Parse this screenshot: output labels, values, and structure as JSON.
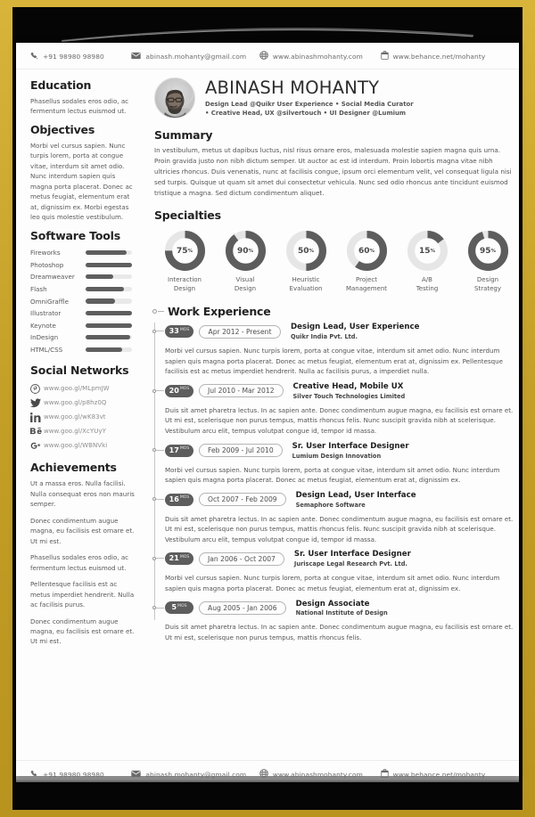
{
  "contact": {
    "phone": "+91 98980 98980",
    "email": "abinash.mohanty@gmail.com",
    "website": "www.abinashmohanty.com",
    "behance": "www.behance.net/mohanty"
  },
  "profile": {
    "name": "ABINASH MOHANTY",
    "subtitle_line1": "Design Lead @Quikr User Experience • Social Media Curator",
    "subtitle_line2": "• Creative Head, UX @silvertouch • UI Designer @Lumium"
  },
  "education": {
    "heading": "Education",
    "text": "Phasellus sodales eros odio, ac fermentum lectus euismod ut."
  },
  "objectives": {
    "heading": "Objectives",
    "text": "Morbi vel cursus sapien. Nunc turpis lorem, porta at congue vitae, interdum sit amet odio. Nunc interdum sapien quis magna porta placerat. Donec ac metus feugiat, elementum erat at, dignissim ex. Morbi egestas leo quis molestie vestibulum."
  },
  "software_tools": {
    "heading": "Software Tools",
    "items": [
      {
        "name": "Fireworks",
        "level": 88
      },
      {
        "name": "Photoshop",
        "level": 100
      },
      {
        "name": "Dreamweaver",
        "level": 60
      },
      {
        "name": "Flash",
        "level": 82
      },
      {
        "name": "OmniGraffle",
        "level": 64
      },
      {
        "name": "Illustrator",
        "level": 100
      },
      {
        "name": "Keynote",
        "level": 100
      },
      {
        "name": "InDesign",
        "level": 96
      },
      {
        "name": "HTML/CSS",
        "level": 78
      }
    ]
  },
  "social_networks": {
    "heading": "Social Networks",
    "items": [
      {
        "icon": "pinterest-icon",
        "url": "www.goo.gl/MLpmJW"
      },
      {
        "icon": "twitter-icon",
        "url": "www.goo.gl/p8hz0Q"
      },
      {
        "icon": "linkedin-icon",
        "url": "www.goo.gl/wK83vt"
      },
      {
        "icon": "behance-icon",
        "url": "www.goo.gl/XcYUyY"
      },
      {
        "icon": "googleplus-icon",
        "url": "www.goo.gl/WBNVki"
      }
    ]
  },
  "achievements": {
    "heading": "Achievements",
    "paragraphs": [
      "Ut a massa eros. Nulla facilisi. Nulla consequat eros non mauris semper.",
      "Donec condimentum augue magna, eu facilisis est ornare et. Ut mi est.",
      "Phasellus sodales eros odio, ac fermentum lectus euismod ut.",
      "Pellentesque facilisis est ac metus imperdiet hendrerit. Nulla ac facilisis purus.",
      "Donec condimentum augue magna, eu facilisis est ornare et. Ut mi est."
    ]
  },
  "summary": {
    "heading": "Summary",
    "text": "In vestibulum, metus ut dapibus luctus, nisl risus ornare eros, malesuada molestie sapien magna quis urna. Proin gravida justo non nibh dictum semper. Ut auctor ac est id interdum. Proin lobortis magna vitae nibh ultricies rhoncus. Duis venenatis, nunc at facilisis congue, ipsum orci elementum velit, vel consequat ligula nisi sed turpis. Quisque ut quam sit amet dui consectetur vehicula. Nunc sed odio rhoncus ante tincidunt euismod tristique a magna. Sed dictum condimentum aliquet."
  },
  "specialties": {
    "heading": "Specialties",
    "items": [
      {
        "value": 75,
        "value_label": "75",
        "unit": "%",
        "label_line1": "Interaction",
        "label_line2": "Design"
      },
      {
        "value": 90,
        "value_label": "90",
        "unit": "%",
        "label_line1": "Visual",
        "label_line2": "Design"
      },
      {
        "value": 50,
        "value_label": "50",
        "unit": "%",
        "label_line1": "Heuristic",
        "label_line2": "Evaluation"
      },
      {
        "value": 60,
        "value_label": "60",
        "unit": "%",
        "label_line1": "Project",
        "label_line2": "Management"
      },
      {
        "value": 15,
        "value_label": "15",
        "unit": "%",
        "label_line1": "A/B",
        "label_line2": "Testing"
      },
      {
        "value": 95,
        "value_label": "95",
        "unit": "%",
        "label_line1": "Design",
        "label_line2": "Strategy"
      }
    ]
  },
  "work_experience": {
    "heading": "Work Experience",
    "jobs": [
      {
        "months": "33",
        "months_unit": "MOS",
        "dates": "Apr 2012 - Present",
        "role": "Design Lead, User Experience",
        "company": "Quikr India Pvt. Ltd.",
        "description": "Morbi vel cursus sapien. Nunc turpis lorem, porta at congue vitae, interdum sit amet odio. Nunc interdum sapien quis magna porta placerat. Donec ac metus feugiat, elementum erat at, dignissim ex. Pellentesque facilisis est ac metus imperdiet hendrerit. Nulla ac facilisis purus, a imperdiet nulla."
      },
      {
        "months": "20",
        "months_unit": "MOS",
        "dates": "Jul 2010 - Mar 2012",
        "role": "Creative Head, Mobile UX",
        "company": "Silver Touch Technologies Limited",
        "description": "Duis sit amet pharetra lectus. In ac sapien ante. Donec condimentum augue magna, eu facilisis est ornare et. Ut mi est, scelerisque non purus tempus, mattis rhoncus felis. Nunc suscipit gravida nibh at scelerisque. Vestibulum arcu elit, tempus volutpat congue id, tempor id massa."
      },
      {
        "months": "17",
        "months_unit": "MOS",
        "dates": "Feb 2009 - Jul 2010",
        "role": "Sr. User Interface Designer",
        "company": "Lumium Design Innovation",
        "description": "Morbi vel cursus sapien. Nunc turpis lorem, porta at congue vitae, interdum sit amet odio. Nunc interdum sapien quis magna porta placerat. Donec ac metus feugiat, elementum erat at, dignissim ex."
      },
      {
        "months": "16",
        "months_unit": "MOS",
        "dates": "Oct 2007 - Feb 2009",
        "role": "Design Lead, User Interface",
        "company": "Semaphore Software",
        "description": "Duis sit amet pharetra lectus. In ac sapien ante. Donec condimentum augue magna, eu facilisis est ornare et. Ut mi est, scelerisque non purus tempus, mattis rhoncus felis. Nunc suscipit gravida nibh at scelerisque. Vestibulum arcu elit, tempus volutpat congue id, tempor id massa."
      },
      {
        "months": "21",
        "months_unit": "MOS",
        "dates": "Jan 2006 - Oct 2007",
        "role": "Sr. User Interface Designer",
        "company": "Juriscape Legal Research Pvt. Ltd.",
        "description": "Morbi vel cursus sapien. Nunc turpis lorem, porta at congue vitae, interdum sit amet odio. Nunc interdum sapien quis magna porta placerat. Donec ac metus feugiat, elementum erat at, dignissim ex."
      },
      {
        "months": "5",
        "months_unit": "MOS",
        "dates": "Aug 2005 - Jan 2006",
        "role": "Design Associate",
        "company": "National Institute of Design",
        "description": "Duis sit amet pharetra lectus. In ac sapien ante. Donec condimentum augue magna, eu facilisis est ornare et. Ut mi est, scelerisque non purus tempus, mattis rhoncus felis."
      }
    ]
  },
  "colors": {
    "frame": "#c9a62b",
    "stage": "#050505",
    "page": "#fdfdfd",
    "accent_dark": "#5d5d5d",
    "track": "#e9e9e9",
    "text": "#555555"
  }
}
